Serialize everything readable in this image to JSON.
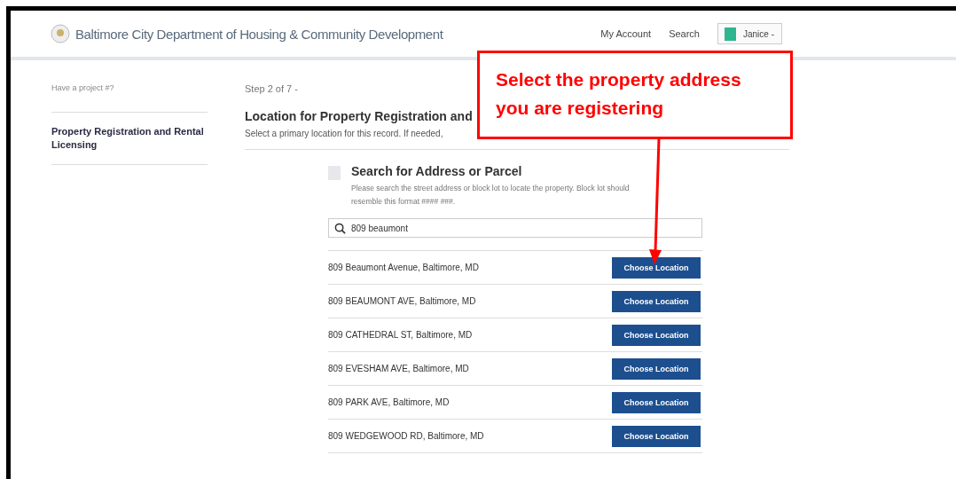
{
  "header": {
    "title": "Baltimore City Department of Housing & Community Development",
    "nav": [
      "My Account",
      "Search"
    ],
    "user": "Janice -"
  },
  "sidebar": {
    "project_label": "Have a project #?",
    "items": [
      {
        "label": "Property Registration and Rental Licensing",
        "selected": true
      }
    ]
  },
  "main": {
    "step": "Step 2 of 7 -",
    "heading": "Location for Property Registration and",
    "subtitle": "Select a primary location for this record. If needed,",
    "search": {
      "title": "Search for Address or Parcel",
      "help": "Please search the street address or block lot to locate the property. Block lot should resemble this format #### ###.",
      "value": "809 beaumont"
    },
    "results": [
      {
        "address": "809 Beaumont Avenue, Baltimore, MD",
        "button": "Choose Location"
      },
      {
        "address": "809 BEAUMONT AVE, Baltimore, MD",
        "button": "Choose Location"
      },
      {
        "address": "809 CATHEDRAL ST, Baltimore, MD",
        "button": "Choose Location"
      },
      {
        "address": "809 EVESHAM AVE, Baltimore, MD",
        "button": "Choose Location"
      },
      {
        "address": "809 PARK AVE, Baltimore, MD",
        "button": "Choose Location"
      },
      {
        "address": "809 WEDGEWOOD RD, Baltimore, MD",
        "button": "Choose Location"
      }
    ]
  },
  "callout": {
    "text": "Select the property address you are registering"
  }
}
